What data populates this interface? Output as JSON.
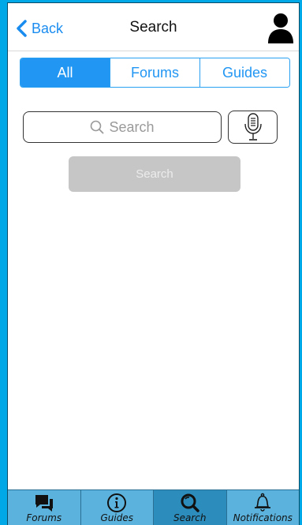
{
  "navbar": {
    "back_label": "Back",
    "title": "Search"
  },
  "segmented": {
    "items": [
      "All",
      "Forums",
      "Guides"
    ],
    "active": "All"
  },
  "search": {
    "placeholder": "Search",
    "button_label": "Search"
  },
  "tabbar": {
    "items": [
      {
        "label": "Forums",
        "icon": "chat-bubbles-icon"
      },
      {
        "label": "Guides",
        "icon": "info-icon"
      },
      {
        "label": "Search",
        "icon": "magnifier-icon"
      },
      {
        "label": "Notifications",
        "icon": "bell-icon"
      }
    ],
    "active": "Search"
  },
  "colors": {
    "frame": "#00a8e8",
    "accent": "#2196f3",
    "tabbar": "#5bb3dd",
    "tab_active": "#2c8dbd",
    "button_disabled": "#c6c6c6"
  }
}
